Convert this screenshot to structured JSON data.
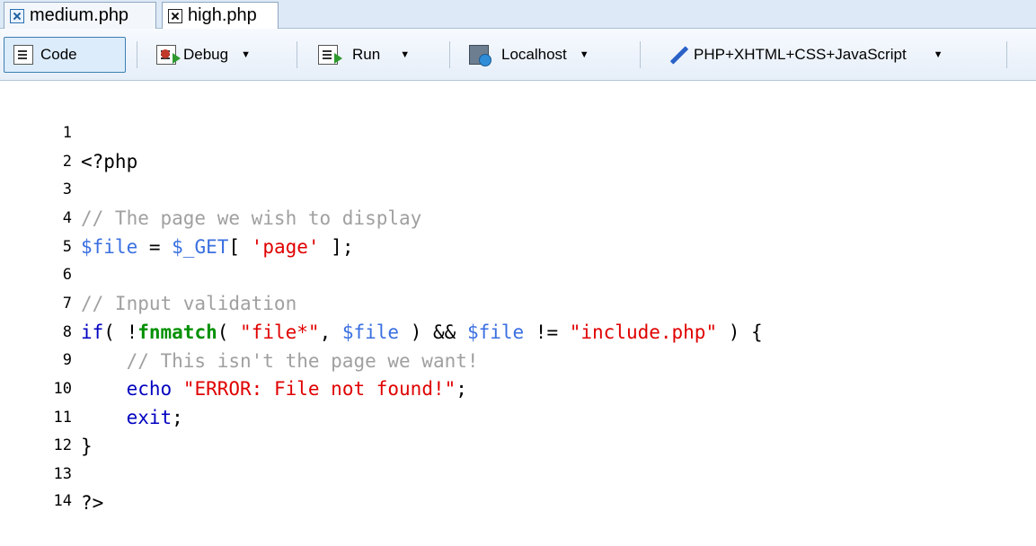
{
  "tabs": [
    {
      "label": "medium.php",
      "active": false
    },
    {
      "label": "high.php",
      "active": true
    }
  ],
  "toolbar": {
    "code_label": "Code",
    "debug_label": "Debug",
    "run_label": "Run",
    "localhost_label": "Localhost",
    "language_label": "PHP+XHTML+CSS+JavaScript"
  },
  "editor": {
    "line_numbers": [
      "1",
      "2",
      "3",
      "4",
      "5",
      "6",
      "7",
      "8",
      "9",
      "10",
      "11",
      "12",
      "13",
      "14"
    ],
    "tokens": {
      "l1_open": "<?php",
      "l3_comment": "// The page we wish to display",
      "l4_var": "$file",
      "l4_op": " = ",
      "l4_get": "$_GET",
      "l4_br1": "[ ",
      "l4_str": "'page'",
      "l4_br2": " ];",
      "l6_comment": "// Input validation",
      "l7_if": "if",
      "l7_p1": "( !",
      "l7_fn": "fnmatch",
      "l7_p2": "( ",
      "l7_str1": "\"file*\"",
      "l7_comma": ", ",
      "l7_var1": "$file",
      "l7_p3": " ) && ",
      "l7_var2": "$file",
      "l7_neq": " != ",
      "l7_str2": "\"include.php\"",
      "l7_end": " ) {",
      "l8_comment": "// This isn't the page we want!",
      "l9_echo": "echo",
      "l9_str": "\"ERROR: File not found!\"",
      "l9_semi": ";",
      "l10_exit": "exit",
      "l10_semi": ";",
      "l11_close": "}",
      "l13_close": "?>"
    }
  },
  "icons": {
    "tab_close": "close-icon",
    "code": "document-icon",
    "debug": "debug-icon",
    "run": "run-icon",
    "localhost": "server-icon",
    "language": "pencil-icon"
  }
}
